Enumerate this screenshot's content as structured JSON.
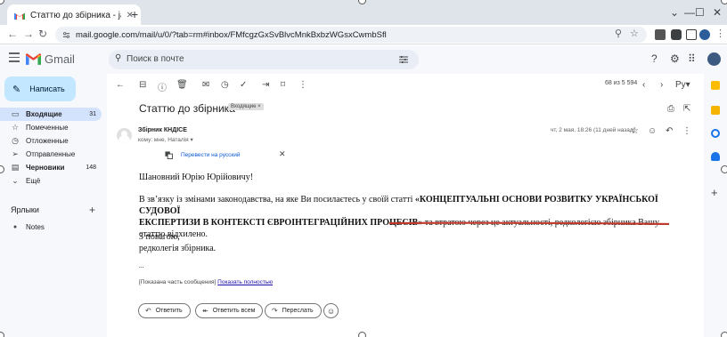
{
  "browser": {
    "tab_title": "Статтю до збірника - jaroslave",
    "tab_close": "✕",
    "new_tab": "+",
    "url": "mail.google.com/mail/u/0/?tab=rm#inbox/FMfcgzGxSvBlvcMnkBxbzWGsxCwmbSfl",
    "window_controls": [
      "⌄",
      "—",
      "☐",
      "✕"
    ]
  },
  "gmail": {
    "logo_text": "Gmail",
    "search_placeholder": "Поиск в почте",
    "compose_label": "Написать",
    "nav": [
      {
        "label": "Входящие",
        "count": "31",
        "icon": "inbox-icon",
        "glyph": "▭",
        "active": true,
        "bold": true
      },
      {
        "label": "Помеченные",
        "count": "",
        "icon": "star-icon",
        "glyph": "☆",
        "active": false,
        "bold": false
      },
      {
        "label": "Отложенные",
        "count": "",
        "icon": "clock-icon",
        "glyph": "◷",
        "active": false,
        "bold": false
      },
      {
        "label": "Отправленные",
        "count": "",
        "icon": "send-icon",
        "glyph": "➢",
        "active": false,
        "bold": false
      },
      {
        "label": "Черновики",
        "count": "148",
        "icon": "draft-icon",
        "glyph": "▤",
        "active": false,
        "bold": true
      },
      {
        "label": "Ещё",
        "count": "",
        "icon": "chevron-down-icon",
        "glyph": "⌄",
        "active": false,
        "bold": false
      }
    ],
    "labels_title": "Ярлыки",
    "labels_add": "+",
    "labels": [
      {
        "label": "Notes",
        "icon": "label-icon",
        "glyph": "●"
      }
    ],
    "pagination": "68 из 5 594"
  },
  "message": {
    "subject": "Статтю до збірника",
    "inbox_chip": "Входящие ×",
    "sender": "Збірник КНДІСЕ",
    "recipients": "кому: мне, Наталія ▾",
    "date": "чт, 2 мая, 18:26 (11 дней назад)",
    "translate_link": "Перевести на русский",
    "translate_close": "✕",
    "greeting": "Шановний Юрію Юрійовичу!",
    "para_line1": "В зв’язку із змінами законодавства, на яке Ви посилаєтесь у своїй статті «КОНЦЕПТУАЛЬНІ ОСНОВИ РОЗВИТКУ УКРАЇНСЬКОЇ СУДОВОЇ",
    "para_line2_bold": "ЕКСПЕРТИЗИ В КОНТЕКСТІ ЄВРОІНТЕГРАЦІЙНИХ ПРОЦЕСІВ»",
    "para_line2_rest": " та втратою через це актуальності, редколегією збірника Вашу статтю відхилено.",
    "closing1": "З повагою,",
    "closing2": "редколегія збірника.",
    "ellipsis": "...",
    "quoted_prefix": "[Показана часть сообщения]  ",
    "show_all": "Показать полностью",
    "reply_label": "Ответить",
    "reply_all_label": "Ответить всем",
    "forward_label": "Переслать",
    "emoji_glyph": "☺"
  },
  "colors": {
    "underline_red": "#c0392b",
    "compose_bg": "#c2e7ff",
    "active_nav_bg": "#d3e3fd",
    "link_blue": "#0b57d0"
  }
}
